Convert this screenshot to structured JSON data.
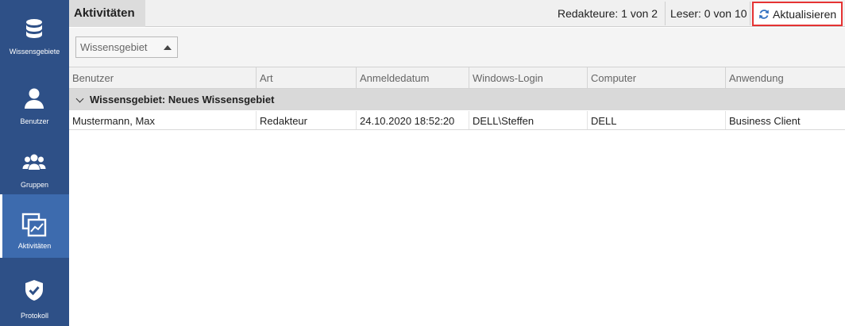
{
  "sidebar": {
    "items": [
      {
        "label": "Wissensgebiete",
        "icon": "database-icon"
      },
      {
        "label": "Benutzer",
        "icon": "user-icon"
      },
      {
        "label": "Gruppen",
        "icon": "group-icon"
      },
      {
        "label": "Aktivitäten",
        "icon": "activity-icon",
        "active": true
      },
      {
        "label": "Protokoll",
        "icon": "shield-check-icon"
      }
    ]
  },
  "header": {
    "title": "Aktivitäten",
    "editors": "Redakteure: 1 von 2",
    "readers": "Leser: 0 von 10",
    "refresh_label": "Aktualisieren"
  },
  "filter": {
    "group_by_label": "Wissensgebiet"
  },
  "grid": {
    "columns": [
      "Benutzer",
      "Art",
      "Anmeldedatum",
      "Windows-Login",
      "Computer",
      "Anwendung"
    ],
    "group_label": "Wissensgebiet: Neues Wissensgebiet",
    "rows": [
      {
        "benutzer": "Mustermann, Max",
        "art": "Redakteur",
        "anmeldedatum": "24.10.2020 18:52:20",
        "windows_login": "DELL\\Steffen",
        "computer": "DELL",
        "anwendung": "Business Client"
      }
    ]
  },
  "colors": {
    "sidebar_bg": "#2e5087",
    "sidebar_active": "#3d6bae",
    "highlight_border": "#e53333",
    "refresh_icon": "#2f6fc0"
  }
}
